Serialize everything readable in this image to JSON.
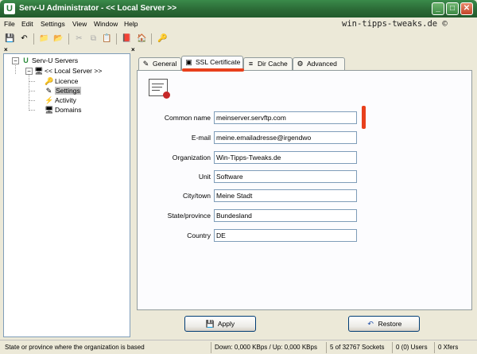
{
  "window": {
    "title": "Serv-U Administrator - << Local Server >>",
    "minimize_glyph": "_",
    "maximize_glyph": "□",
    "close_glyph": "✕"
  },
  "menu": [
    "File",
    "Edit",
    "Settings",
    "View",
    "Window",
    "Help"
  ],
  "watermark": "win-tipps-tweaks.de ©",
  "toolbar": {
    "icons": [
      "save-icon",
      "undo-icon",
      "folder-up-icon",
      "folder-new-icon",
      "cut-icon",
      "copy-icon",
      "paste-icon",
      "book-icon",
      "home-icon",
      "wizard-icon"
    ]
  },
  "pane_close": "×",
  "tree": {
    "root": {
      "label": "Serv-U Servers",
      "toggle": "−"
    },
    "server": {
      "label": "<< Local Server >>",
      "toggle": "−"
    },
    "children": [
      {
        "label": "Licence"
      },
      {
        "label": "Settings"
      },
      {
        "label": "Activity"
      },
      {
        "label": "Domains"
      }
    ]
  },
  "tabs": [
    "General",
    "SSL Certificate",
    "Dir Cache",
    "Advanced"
  ],
  "active_tab": "SSL Certificate",
  "form": {
    "fields": [
      {
        "label": "Common name",
        "value": "meinserver.servftp.com"
      },
      {
        "label": "E-mail",
        "value": "meine.emailadresse@irgendwo"
      },
      {
        "label": "Organization",
        "value": "Win-Tipps-Tweaks.de"
      },
      {
        "label": "Unit",
        "value": "Software"
      },
      {
        "label": "City/town",
        "value": "Meine Stadt"
      },
      {
        "label": "State/province",
        "value": "Bundesland"
      },
      {
        "label": "Country",
        "value": "DE"
      }
    ]
  },
  "buttons": {
    "apply": "Apply",
    "restore": "Restore"
  },
  "statusbar": [
    "State or province where the organization is based",
    "Down: 0,000 KBps / Up: 0,000 KBps",
    "5 of 32767 Sockets",
    "0 (0) Users",
    "0 Xfers"
  ],
  "colors": {
    "titlebar": "#2b6a36",
    "annotation": "#e8401c",
    "selection": "#c2c2c2"
  }
}
